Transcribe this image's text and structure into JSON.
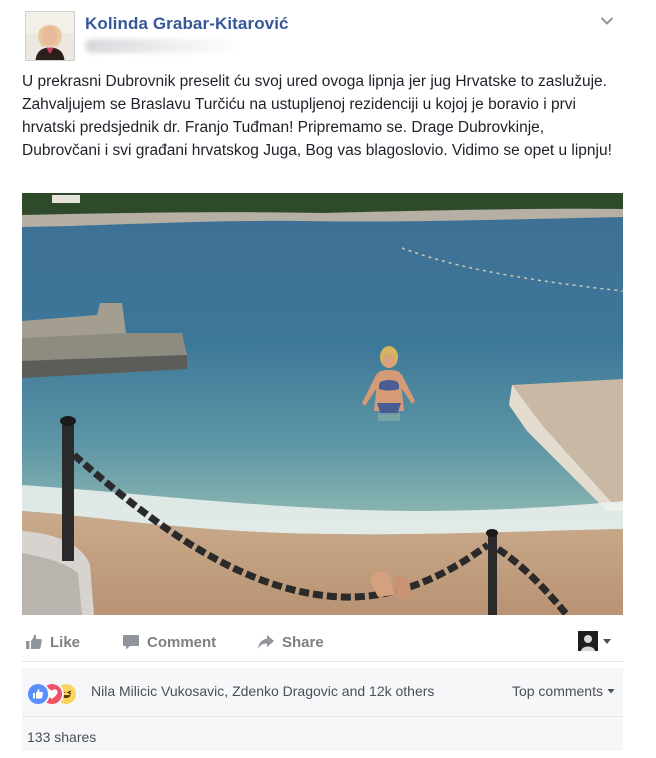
{
  "post": {
    "author": "Kolinda Grabar-Kitarović",
    "text": "U prekrasni Dubrovnik preselit ću svoj ured ovoga lipnja jer jug Hrvatske to zaslužuje. Zahvaljujem se Braslavu Turčiću na ustupljenoj rezidenciji u kojoj je boravio i prvi hrvatski predsjednik dr. Franjo Tuđman! Pripremamo se. Drage Dubrovkinje, Dubrovčani i svi građani hrvatskog Juga, Bog vas blagoslovio. Vidimo se opet u lipnju!",
    "icons": {
      "menu": "chevron-down-icon"
    }
  },
  "actions": {
    "like_label": "Like",
    "comment_label": "Comment",
    "share_label": "Share",
    "icons": {
      "like": "thumbs-up-icon",
      "comment": "comment-bubble-icon",
      "share": "share-arrow-icon",
      "viewer": "avatar-select-icon"
    }
  },
  "reactions": {
    "types": [
      "like",
      "love",
      "haha"
    ],
    "summary": "Nila Milicic Vukosavic, Zdenko Dragovic and 12k others",
    "top_comments_label": "Top comments"
  },
  "shares": {
    "label": "133 shares"
  },
  "colors": {
    "author_link": "#365899",
    "text": "#1d2129",
    "muted": "#7f7f7f",
    "panel_bg": "#f6f7f9",
    "like_blue": "#5890ff",
    "love_red": "#f25268",
    "haha_yellow": "#fcd460"
  }
}
